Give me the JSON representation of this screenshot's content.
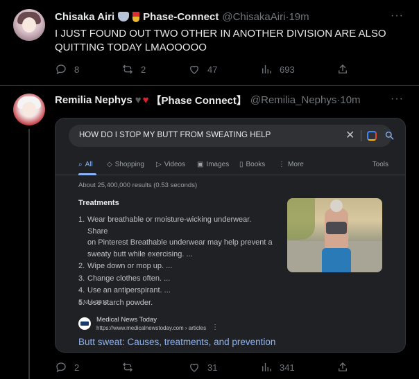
{
  "tweets": [
    {
      "display_name": "Chisaka Airi",
      "affiliation": "Phase-Connect",
      "handle": "@ChisakaAiri",
      "time": "19m",
      "text_line1": "I JUST FOUND OUT TWO OTHER IN ANOTHER DIVISION ARE ALSO",
      "text_line2": "QUITTING TODAY LMAOOOOO",
      "replies": "8",
      "reposts": "2",
      "likes": "47",
      "views": "693"
    },
    {
      "display_name": "Remilia Nephys",
      "affiliation": "【Phase Connect】",
      "handle": "@Remilia_Nephys",
      "time": "10m",
      "replies": "2",
      "reposts": "",
      "likes": "31",
      "views": "341"
    }
  ],
  "separator": " · ",
  "more_glyph": "···",
  "google": {
    "query": "HOW DO I STOP MY BUTT FROM SWEATING HELP",
    "tabs": [
      "All",
      "Shopping",
      "Videos",
      "Images",
      "Books",
      "More"
    ],
    "tools": "Tools",
    "results_count": "About 25,400,000 results (0.53 seconds)",
    "heading": "Treatments",
    "items": [
      {
        "n": "1.",
        "line1": "Wear breathable or moisture-wicking underwear. Share",
        "line2": "on Pinterest Breathable underwear may help prevent a",
        "line3": "sweaty butt while exercising. ..."
      },
      {
        "n": "2.",
        "line1": "Wipe down or mop up. ..."
      },
      {
        "n": "3.",
        "line1": "Change clothes often. ..."
      },
      {
        "n": "4.",
        "line1": "Use an antiperspirant. ..."
      },
      {
        "n": "5.",
        "line1": "Use starch powder."
      }
    ],
    "date": "4 Nov 2019",
    "source_name": "Medical News Today",
    "source_url": "https://www.medicalnewstoday.com › articles",
    "source_more": "⋮",
    "link_title": "Butt sweat: Causes, treatments, and prevention"
  },
  "icons": {
    "reply": "reply-icon",
    "repost": "repost-icon",
    "like": "heart-icon",
    "views": "views-icon",
    "share": "share-icon"
  },
  "colors": {
    "background": "#000000",
    "text": "#e7e9ea",
    "muted": "#71767b",
    "google_link": "#8ab4f8",
    "google_bg": "#202124"
  }
}
